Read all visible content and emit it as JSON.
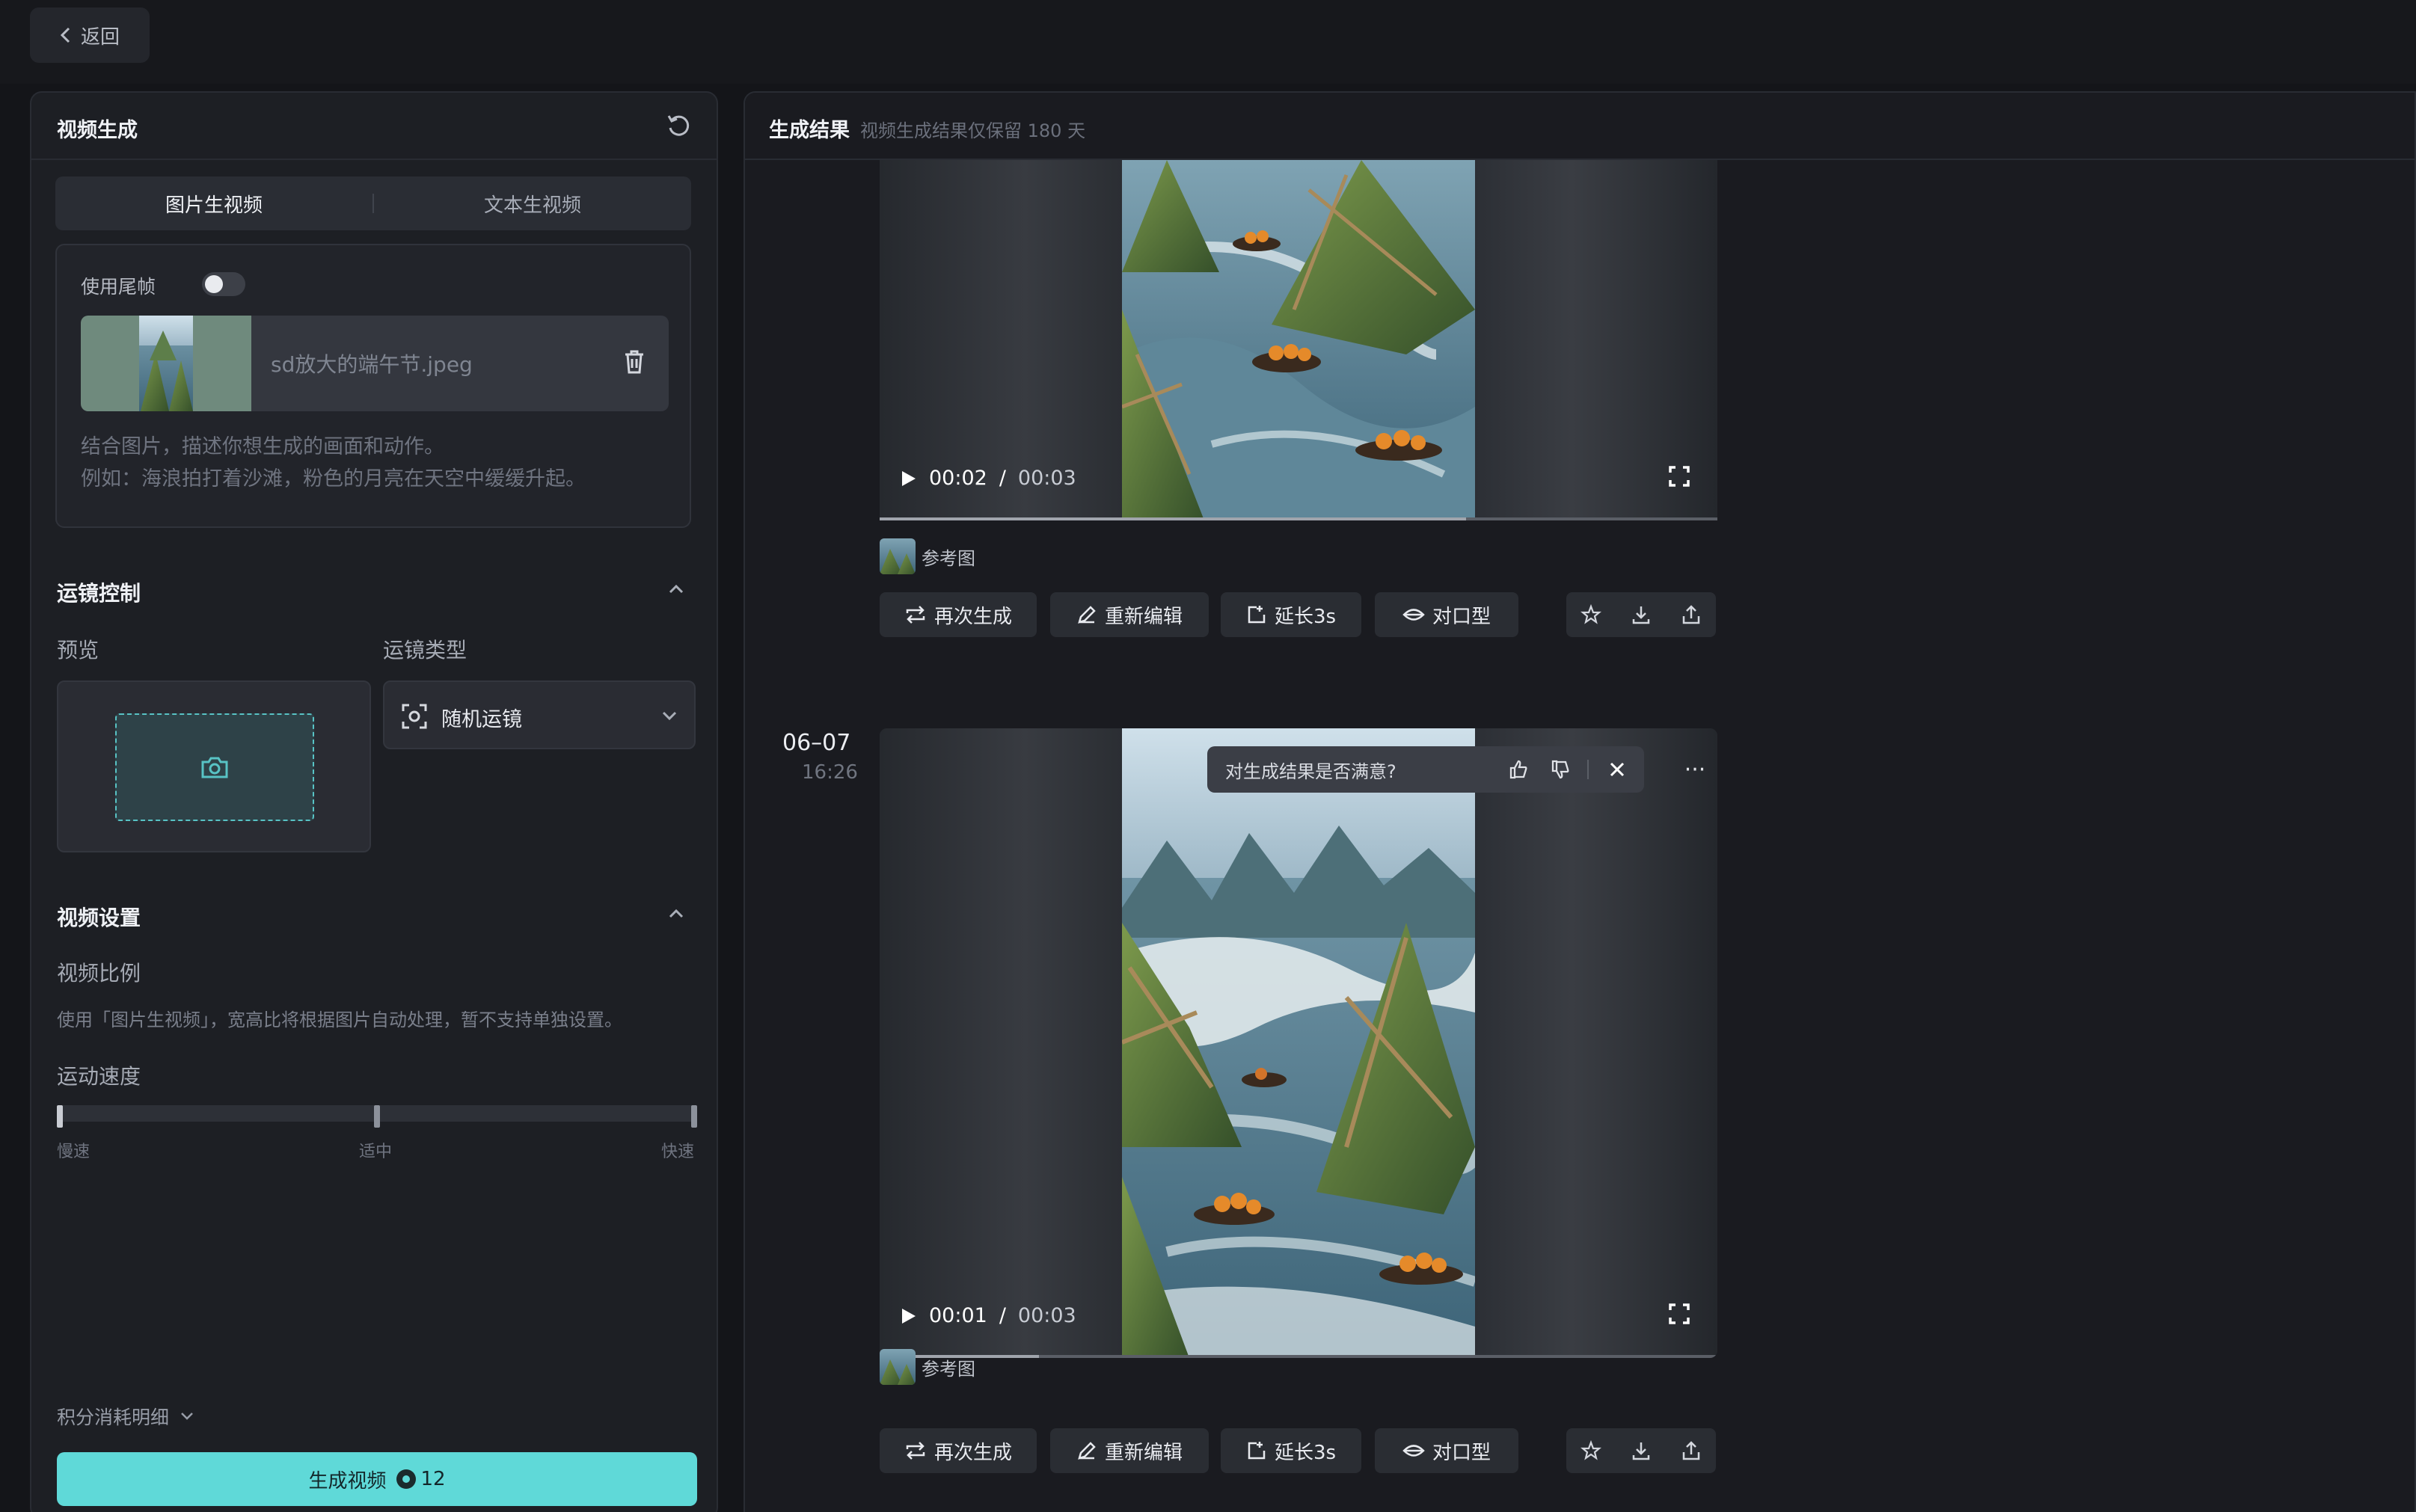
{
  "header": {
    "back_label": "返回"
  },
  "left_panel": {
    "title": "视频生成",
    "tabs": [
      {
        "label": "图片生视频",
        "active": true
      },
      {
        "label": "文本生视频",
        "active": false
      }
    ],
    "use_tail_frame_label": "使用尾帧",
    "use_tail_frame_enabled": false,
    "uploaded_file": "sd放大的端午节.jpeg",
    "prompt_hint_line1": "结合图片，描述你想生成的画面和动作。",
    "prompt_hint_line2": "例如：海浪拍打着沙滩，粉色的月亮在天空中缓缓升起。",
    "camera_section_title": "运镜控制",
    "preview_label": "预览",
    "camera_type_label": "运镜类型",
    "camera_type_value": "随机运镜",
    "video_settings_title": "视频设置",
    "ratio_label": "视频比例",
    "ratio_hint": "使用「图片生视频」，宽高比将根据图片自动处理，暂不支持单独设置。",
    "speed_label": "运动速度",
    "speed_options": [
      "慢速",
      "适中",
      "快速"
    ],
    "speed_selected": "慢速",
    "cost_detail_label": "积分消耗明细",
    "generate_label": "生成视频",
    "generate_cost": "12"
  },
  "right_panel": {
    "title": "生成结果",
    "subtitle": "视频生成结果仅保留 180 天",
    "results": [
      {
        "current_time": "00:02",
        "separator": "/",
        "duration": "00:03",
        "progress": 0.7,
        "ref_label": "参考图",
        "actions": [
          "再次生成",
          "重新编辑",
          "延长3s",
          "对口型"
        ]
      },
      {
        "date": "06–07",
        "time": "16:26",
        "feedback_question": "对生成结果是否满意?",
        "current_time": "00:01",
        "separator": "/",
        "duration": "00:03",
        "progress": 0.19,
        "ref_label": "参考图",
        "actions": [
          "再次生成",
          "重新编辑",
          "延长3s",
          "对口型"
        ]
      }
    ]
  },
  "colors": {
    "accent": "#5fd9d8",
    "background": "#141519",
    "panel": "#1d1f24"
  },
  "icons": [
    "chevron-left-icon",
    "refresh-icon",
    "trash-icon",
    "camera-icon",
    "focus-icon",
    "chevron-down-icon",
    "chevron-up-icon",
    "play-icon",
    "fullscreen-icon",
    "repeat-icon",
    "edit-icon",
    "extend-icon",
    "lip-sync-icon",
    "star-icon",
    "download-icon",
    "share-icon",
    "thumbs-up-icon",
    "thumbs-down-icon",
    "close-icon",
    "more-icon",
    "coin-icon"
  ]
}
